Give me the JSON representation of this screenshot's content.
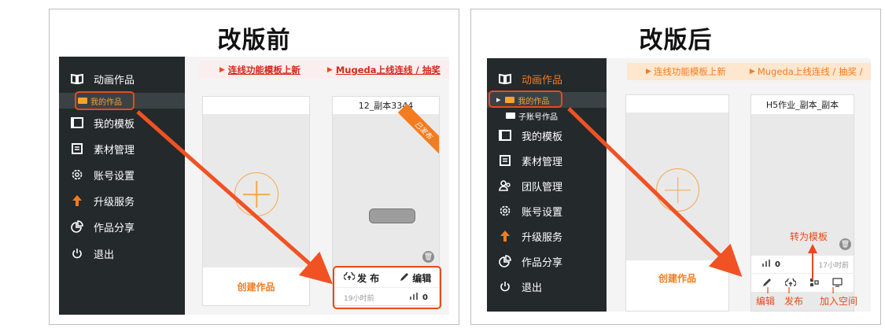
{
  "before": {
    "title": "改版前",
    "sidebar": {
      "items": [
        {
          "label": "动画作品"
        },
        {
          "label": "我的模板"
        },
        {
          "label": "素材管理"
        },
        {
          "label": "账号设置"
        },
        {
          "label": "升级服务"
        },
        {
          "label": "作品分享"
        },
        {
          "label": "退出"
        }
      ],
      "sub_items": [
        {
          "label": "我的作品"
        }
      ]
    },
    "banner": {
      "link1": "连线功能模板上新",
      "link2": "Mugeda上线连线 / 抽奖"
    },
    "create_card": {
      "label": "创建作品"
    },
    "work_card": {
      "title": "12_副本3344",
      "ribbon": "已发布",
      "publish_label": "发 布",
      "edit_label": "编辑",
      "time": "19小时前",
      "views": "0"
    }
  },
  "after": {
    "title": "改版后",
    "sidebar": {
      "items": [
        {
          "label": "动画作品"
        },
        {
          "label": "我的模板"
        },
        {
          "label": "素材管理"
        },
        {
          "label": "团队管理"
        },
        {
          "label": "账号设置"
        },
        {
          "label": "升级服务"
        },
        {
          "label": "作品分享"
        },
        {
          "label": "退出"
        }
      ],
      "sub_items": [
        {
          "label": "我的作品"
        },
        {
          "label": "子账号作品"
        }
      ]
    },
    "banner": {
      "link1": "连线功能模板上新",
      "link2": "Mugeda上线连线 / 抽奖 /"
    },
    "create_card": {
      "label": "创建作品"
    },
    "work_card": {
      "title": "H5作业_副本_副本",
      "views": "0",
      "time": "17小时前"
    },
    "annotations": {
      "to_template": "转为模板",
      "edit": "编辑",
      "publish": "发布",
      "add_space": "加入空间"
    }
  },
  "colors": {
    "accent": "#f47c1f",
    "annotation": "#e84a1c",
    "sidebar_bg": "#24292b",
    "banner_bg_after": "#fde7cf",
    "banner_bg_before": "#fbeeee"
  }
}
